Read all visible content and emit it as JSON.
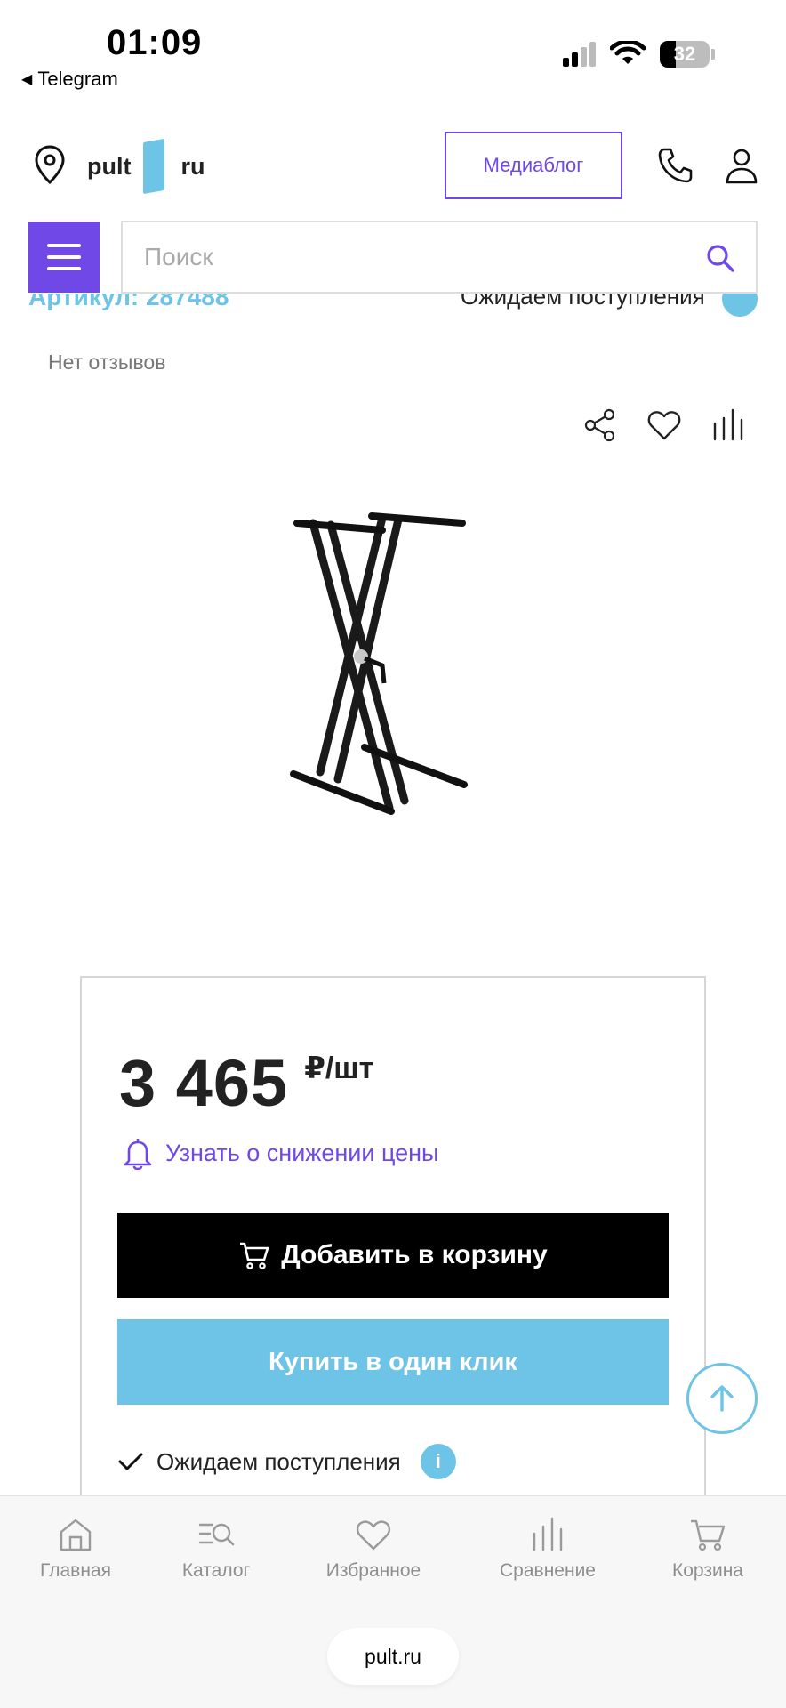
{
  "status_bar": {
    "time": "01:09",
    "back_app": "Telegram",
    "battery": "32"
  },
  "header": {
    "logo_left": "pult",
    "logo_right": "ru",
    "mediablog": "Медиаблог"
  },
  "search": {
    "placeholder": "Поиск",
    "value": ""
  },
  "partial": {
    "left": "Артикул: 287488",
    "right": "Ожидаем поступления"
  },
  "reviews": "Нет отзывов",
  "price": {
    "value": "3 465",
    "unit": "₽/шт"
  },
  "notify_label": "Узнать о снижении цены",
  "add_to_cart": "Добавить в корзину",
  "buy_one_click": "Купить в один клик",
  "availability": "Ожидаем поступления",
  "info_glyph": "i",
  "bottom_nav": [
    {
      "label": "Главная",
      "icon": "home-icon"
    },
    {
      "label": "Каталог",
      "icon": "catalog-icon"
    },
    {
      "label": "Избранное",
      "icon": "heart-icon"
    },
    {
      "label": "Сравнение",
      "icon": "compare-icon"
    },
    {
      "label": "Корзина",
      "icon": "cart-icon"
    }
  ],
  "url": "pult.ru",
  "colors": {
    "accent": "#7048e8",
    "brand_blue": "#6ec4e6",
    "black": "#000000"
  }
}
